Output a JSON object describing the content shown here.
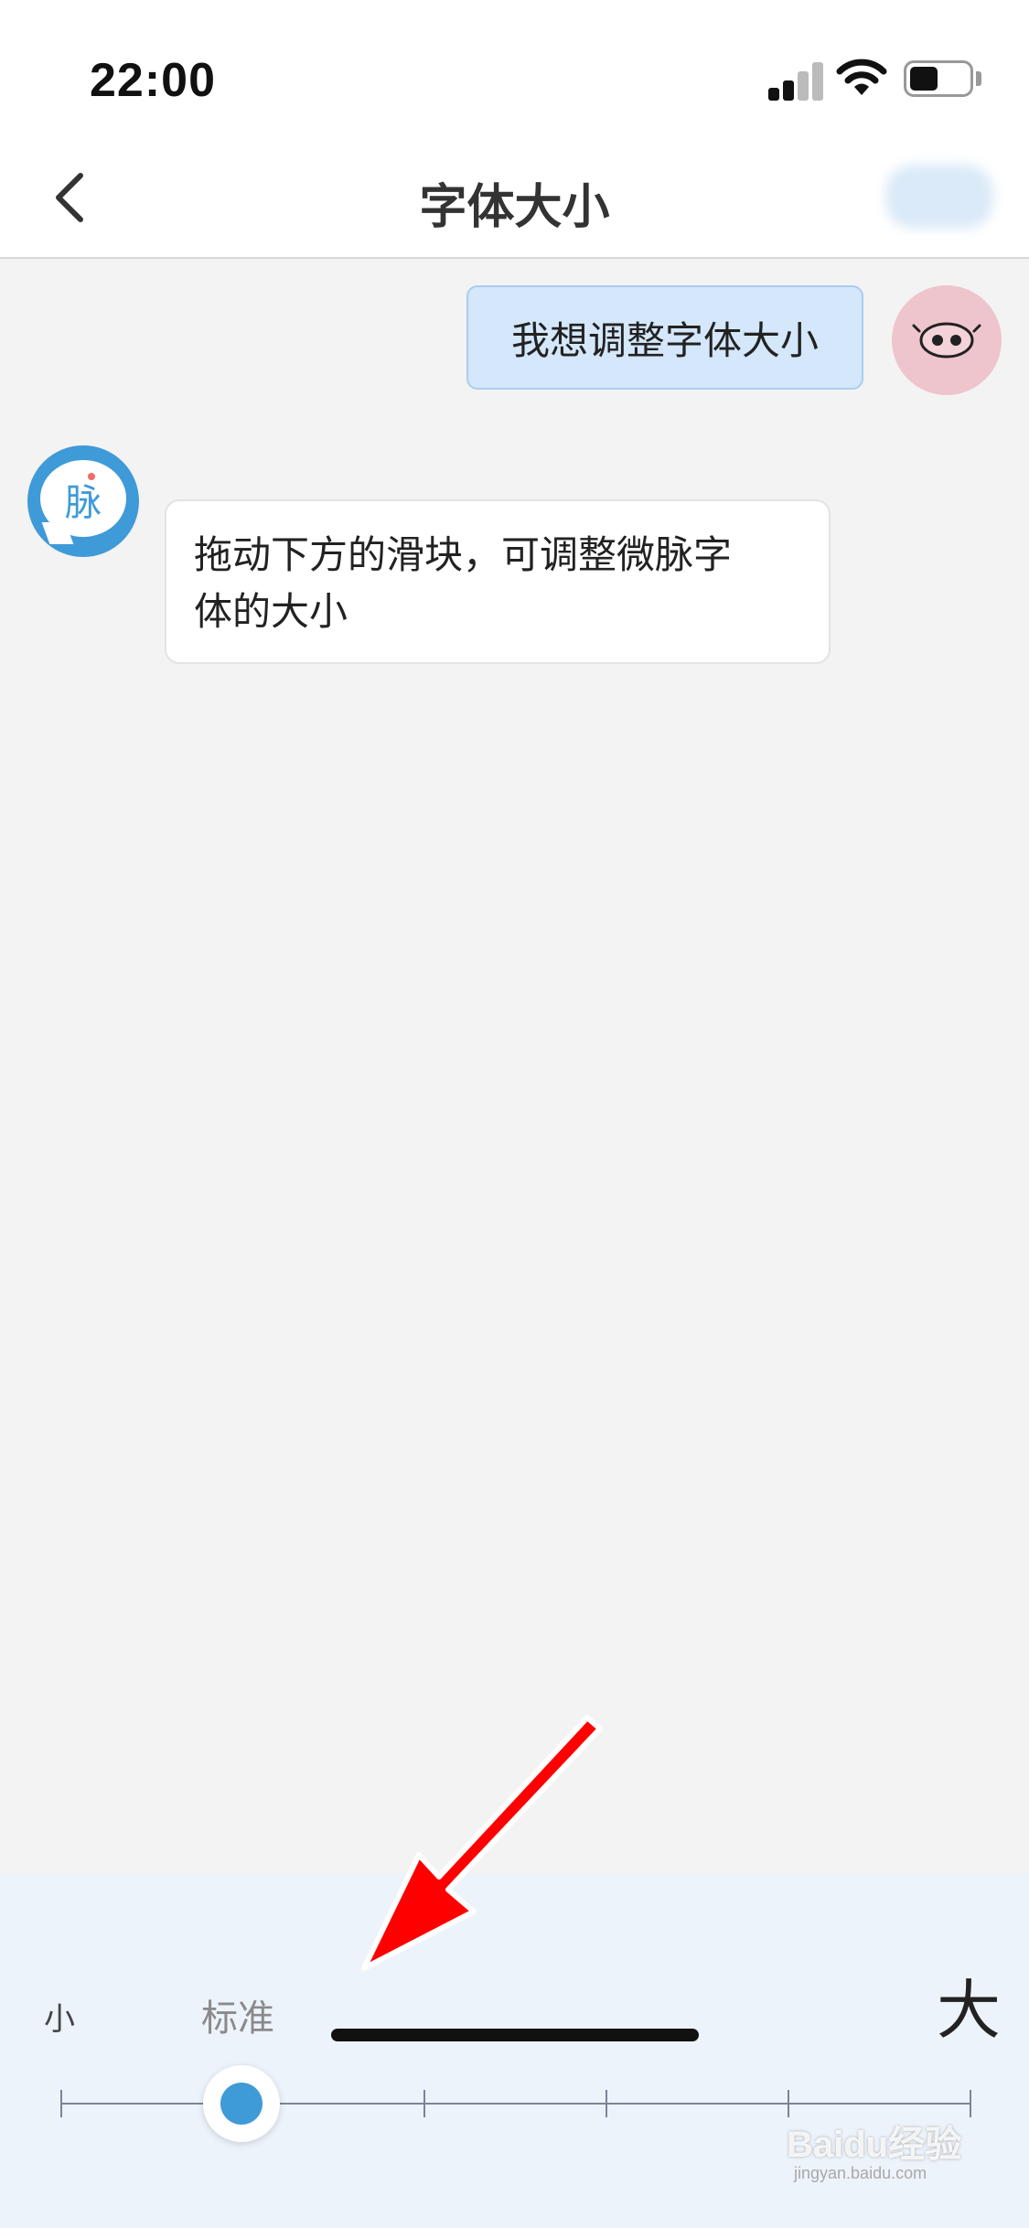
{
  "status_bar": {
    "time": "22:00",
    "icons": [
      "cellular-signal-icon",
      "wifi-icon",
      "battery-icon"
    ]
  },
  "nav": {
    "title": "字体大小",
    "back_icon": "chevron-left-icon"
  },
  "chat": {
    "user_message": "我想调整字体大小",
    "bot_message_line1": "拖动下方的滑块，可调整微脉字",
    "bot_message_line2": "体的大小",
    "bot_avatar_glyph": "脉"
  },
  "font_size": {
    "label_small": "小",
    "label_standard": "标准",
    "label_large": "大",
    "levels": 6,
    "selected_level": 2
  },
  "watermark": {
    "brand": "Baidu经验",
    "url": "jingyan.baidu.com"
  },
  "colors": {
    "accent": "#3f9ad8",
    "user_bubble": "#d4e7fb",
    "panel_bg": "#edf3fb",
    "annotation_arrow": "#ff0000"
  }
}
